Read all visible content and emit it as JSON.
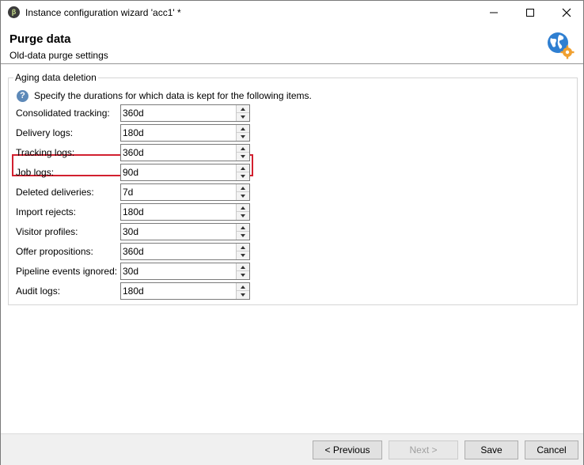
{
  "window": {
    "title": "Instance configuration wizard 'acc1' *",
    "app_icon_glyph": "β",
    "app_icon": "app-logo-icon",
    "controls": [
      "minimize-icon",
      "maximize-icon",
      "close-icon"
    ]
  },
  "header": {
    "title": "Purge data",
    "subtitle": "Old-data purge settings",
    "icon": "globe-settings-icon"
  },
  "group": {
    "legend": "Aging data deletion",
    "help_glyph": "?",
    "help_text": "Specify the durations for which data is kept for the following items."
  },
  "fields": [
    {
      "label": "Consolidated tracking:",
      "value": "360d"
    },
    {
      "label": "Delivery logs:",
      "value": "180d"
    },
    {
      "label": "Tracking logs:",
      "value": "360d",
      "highlighted": true
    },
    {
      "label": "Job logs:",
      "value": "90d"
    },
    {
      "label": "Deleted deliveries:",
      "value": "7d"
    },
    {
      "label": "Import rejects:",
      "value": "180d"
    },
    {
      "label": "Visitor profiles:",
      "value": "30d"
    },
    {
      "label": "Offer propositions:",
      "value": "360d"
    },
    {
      "label": "Pipeline events ignored:",
      "value": "30d"
    },
    {
      "label": "Audit logs:",
      "value": "180d"
    }
  ],
  "footer": {
    "previous": "< Previous",
    "next": "Next >",
    "save": "Save",
    "cancel": "Cancel",
    "next_enabled": false
  },
  "colors": {
    "highlight": "#d2202f",
    "help_icon": "#5d89b8",
    "globe": "#2f7fd1",
    "gear": "#f0a030"
  }
}
